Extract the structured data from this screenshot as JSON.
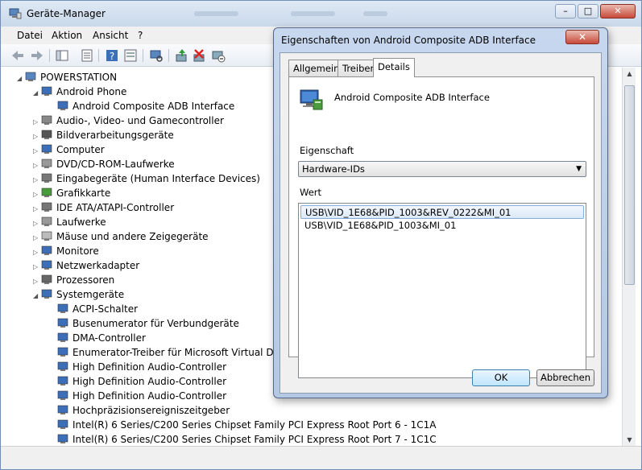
{
  "window": {
    "title": "Geräte-Manager",
    "controls": {
      "minimize": "–",
      "maximize": "□",
      "close": "✕"
    }
  },
  "menu": [
    "Datei",
    "Aktion",
    "Ansicht",
    "?"
  ],
  "toolbar_icons": [
    "back-arrow-icon",
    "forward-arrow-icon",
    "show-hide-console-icon",
    "properties-icon",
    "help-icon",
    "view-icon",
    "scan-hardware-icon",
    "update-driver-icon",
    "disable-device-icon",
    "uninstall-device-icon"
  ],
  "tree": [
    {
      "label": "POWERSTATION",
      "level": 0,
      "exp": "◢",
      "icon": "computer-icon"
    },
    {
      "label": "Android Phone",
      "level": 1,
      "exp": "◢",
      "icon": "phone-device-icon"
    },
    {
      "label": "Android Composite ADB Interface",
      "level": 2,
      "exp": "",
      "icon": "device-icon"
    },
    {
      "label": "Audio-, Video- und Gamecontroller",
      "level": 1,
      "exp": "▷",
      "icon": "speaker-icon"
    },
    {
      "label": "Bildverarbeitungsgeräte",
      "level": 1,
      "exp": "▷",
      "icon": "camera-icon"
    },
    {
      "label": "Computer",
      "level": 1,
      "exp": "▷",
      "icon": "monitor-icon"
    },
    {
      "label": "DVD/CD-ROM-Laufwerke",
      "level": 1,
      "exp": "▷",
      "icon": "disc-drive-icon"
    },
    {
      "label": "Eingabegeräte (Human Interface Devices)",
      "level": 1,
      "exp": "▷",
      "icon": "hid-icon"
    },
    {
      "label": "Grafikkarte",
      "level": 1,
      "exp": "▷",
      "icon": "display-adapter-icon"
    },
    {
      "label": "IDE ATA/ATAPI-Controller",
      "level": 1,
      "exp": "▷",
      "icon": "ide-controller-icon"
    },
    {
      "label": "Laufwerke",
      "level": 1,
      "exp": "▷",
      "icon": "disk-drive-icon"
    },
    {
      "label": "Mäuse und andere Zeigegeräte",
      "level": 1,
      "exp": "▷",
      "icon": "mouse-icon"
    },
    {
      "label": "Monitore",
      "level": 1,
      "exp": "▷",
      "icon": "monitor-icon"
    },
    {
      "label": "Netzwerkadapter",
      "level": 1,
      "exp": "▷",
      "icon": "network-adapter-icon"
    },
    {
      "label": "Prozessoren",
      "level": 1,
      "exp": "▷",
      "icon": "processor-icon"
    },
    {
      "label": "Systemgeräte",
      "level": 1,
      "exp": "◢",
      "icon": "system-device-icon"
    },
    {
      "label": "ACPI-Schalter",
      "level": 2,
      "exp": "",
      "icon": "system-device-icon"
    },
    {
      "label": "Busenumerator für Verbundgeräte",
      "level": 2,
      "exp": "",
      "icon": "system-device-icon"
    },
    {
      "label": "DMA-Controller",
      "level": 2,
      "exp": "",
      "icon": "system-device-icon"
    },
    {
      "label": "Enumerator-Treiber für Microsoft Virtual Drive",
      "level": 2,
      "exp": "",
      "icon": "system-device-icon"
    },
    {
      "label": "High Definition Audio-Controller",
      "level": 2,
      "exp": "",
      "icon": "system-device-icon"
    },
    {
      "label": "High Definition Audio-Controller",
      "level": 2,
      "exp": "",
      "icon": "system-device-icon"
    },
    {
      "label": "High Definition Audio-Controller",
      "level": 2,
      "exp": "",
      "icon": "system-device-icon"
    },
    {
      "label": "Hochpräzisionsereigniszeitgeber",
      "level": 2,
      "exp": "",
      "icon": "system-device-icon"
    },
    {
      "label": "Intel(R) 6 Series/C200 Series Chipset Family PCI Express Root Port 6 - 1C1A",
      "level": 2,
      "exp": "",
      "icon": "system-device-icon"
    },
    {
      "label": "Intel(R) 6 Series/C200 Series Chipset Family PCI Express Root Port 7 - 1C1C",
      "level": 2,
      "exp": "",
      "icon": "system-device-icon"
    }
  ],
  "dialog": {
    "title": "Eigenschaften von Android Composite ADB Interface",
    "close": "✕",
    "tabs": [
      "Allgemein",
      "Treiber",
      "Details"
    ],
    "active_tab": "Details",
    "device_name": "Android Composite ADB Interface",
    "property_label": "Eigenschaft",
    "property_value": "Hardware-IDs",
    "value_label": "Wert",
    "values": [
      "USB\\VID_1E68&PID_1003&REV_0222&MI_01",
      "USB\\VID_1E68&PID_1003&MI_01"
    ],
    "ok": "OK",
    "cancel": "Abbrechen"
  }
}
